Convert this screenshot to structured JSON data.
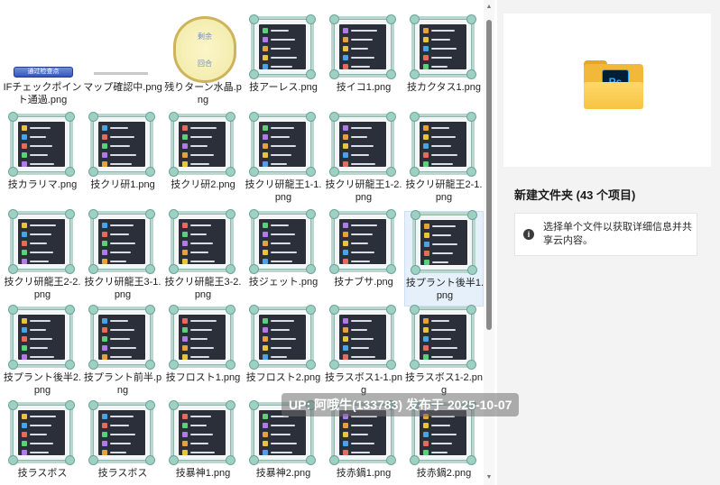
{
  "files": [
    {
      "name": "IFチェックポイント通過.png",
      "kind": "banner",
      "banner": "通过检查点"
    },
    {
      "name": "マップ確認中.png",
      "kind": "strip"
    },
    {
      "name": "残りターン水晶.png",
      "kind": "medal",
      "medal_top": "剩余",
      "medal_bottom": "回合"
    },
    {
      "name": "技アーレス.png",
      "kind": "skill"
    },
    {
      "name": "技イコ1.png",
      "kind": "skill"
    },
    {
      "name": "技カクタス1.png",
      "kind": "skill"
    },
    {
      "name": "技カラリマ.png",
      "kind": "skill"
    },
    {
      "name": "技クリ研1.png",
      "kind": "skill"
    },
    {
      "name": "技クリ研2.png",
      "kind": "skill"
    },
    {
      "name": "技クリ研龍王1-1.png",
      "kind": "skill"
    },
    {
      "name": "技クリ研龍王1-2.png",
      "kind": "skill"
    },
    {
      "name": "技クリ研龍王2-1.png",
      "kind": "skill"
    },
    {
      "name": "技クリ研龍王2-2.png",
      "kind": "skill"
    },
    {
      "name": "技クリ研龍王3-1.png",
      "kind": "skill"
    },
    {
      "name": "技クリ研龍王3-2.png",
      "kind": "skill"
    },
    {
      "name": "技ジェット.png",
      "kind": "skill"
    },
    {
      "name": "技ナブサ.png",
      "kind": "skill"
    },
    {
      "name": "技プラント後半1.png",
      "kind": "skill",
      "selected": true
    },
    {
      "name": "技プラント後半2.png",
      "kind": "skill"
    },
    {
      "name": "技プラント前半.png",
      "kind": "skill"
    },
    {
      "name": "技フロスト1.png",
      "kind": "skill"
    },
    {
      "name": "技フロスト2.png",
      "kind": "skill"
    },
    {
      "name": "技ラスボス1-1.png",
      "kind": "skill"
    },
    {
      "name": "技ラスボス1-2.png",
      "kind": "skill"
    },
    {
      "name": "技ラスボス",
      "kind": "skill"
    },
    {
      "name": "技ラスボス",
      "kind": "skill"
    },
    {
      "name": "技暴神1.png",
      "kind": "skill"
    },
    {
      "name": "技暴神2.png",
      "kind": "skill"
    },
    {
      "name": "技赤鍋1.png",
      "kind": "skill"
    },
    {
      "name": "技赤鍋2.png",
      "kind": "skill"
    }
  ],
  "icon_colors": [
    "#e8c43a",
    "#4aa3e8",
    "#e86a5a",
    "#5bd07a",
    "#b07ae8",
    "#e8a03a"
  ],
  "details": {
    "folder_badge": "Ps",
    "folder_title": "新建文件夹 (43 个项目)",
    "info_icon": "info-icon",
    "info_text": "选择单个文件以获取详细信息并共享云内容。"
  },
  "watermark": "UP: 阿哦牛(133783) 发布于 2025-10-07"
}
